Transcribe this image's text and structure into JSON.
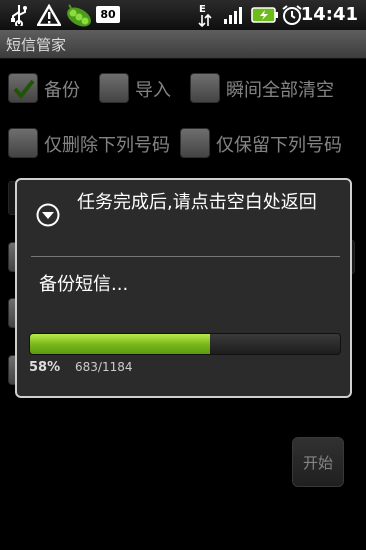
{
  "status_bar": {
    "notification_count": "80",
    "time": "14:41",
    "icons": [
      "usb-icon",
      "warning-icon",
      "peapod-app-icon",
      "data-transfer-icon",
      "signal-icon",
      "battery-charging-icon",
      "alarm-icon"
    ]
  },
  "app": {
    "title": "短信管家"
  },
  "options": {
    "backup": {
      "label": "备份",
      "checked": true
    },
    "import": {
      "label": "导入",
      "checked": false
    },
    "clear_all": {
      "label": "瞬间全部清空",
      "checked": false
    },
    "delete_only": {
      "label": "仅删除下列号码",
      "checked": false
    },
    "keep_only": {
      "label": "仅保留下列号码",
      "checked": false
    }
  },
  "start_button": {
    "label": "开始"
  },
  "dialog": {
    "title": "任务完成后,请点击空白处返回",
    "message": "备份短信...",
    "progress": {
      "percent_label": "58%",
      "count_label": "683/1184",
      "fraction": 0.58
    }
  },
  "colors": {
    "progress_green": "#8bc92a",
    "dialog_border": "#cfcfcf"
  }
}
